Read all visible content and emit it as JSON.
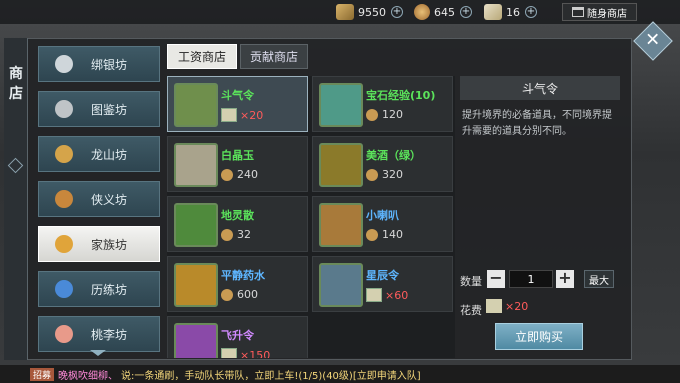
{
  "topbar": {
    "silver": "9550",
    "coins": "645",
    "tickets": "16",
    "shop_label": "随身商店"
  },
  "panel": {
    "vertical_title": "商\n店"
  },
  "sidebar": {
    "items": [
      {
        "label": "绑银坊",
        "icon": "silver-icon",
        "color": "#cfd6da"
      },
      {
        "label": "图鉴坊",
        "icon": "book-icon",
        "color": "#bfc4c7"
      },
      {
        "label": "龙山坊",
        "icon": "dragon-icon",
        "color": "#d5a44a"
      },
      {
        "label": "侠义坊",
        "icon": "medal-icon",
        "color": "#c8873c"
      },
      {
        "label": "家族坊",
        "icon": "ingot-icon",
        "color": "#e0a43a"
      },
      {
        "label": "历练坊",
        "icon": "orb-icon",
        "color": "#4a8ad8"
      },
      {
        "label": "桃李坊",
        "icon": "peach-icon",
        "color": "#e89a8a"
      }
    ]
  },
  "tabs": [
    "工资商店",
    "贡献商店"
  ],
  "items": [
    {
      "name": "斗气令",
      "price": "×20",
      "currency": "ticket",
      "name_color": "green",
      "price_color": "red",
      "icon_color": "#6f8f4c"
    },
    {
      "name": "宝石经验(10)",
      "price": "120",
      "currency": "coin",
      "name_color": "green",
      "price_color": "",
      "icon_color": "#4f9a88"
    },
    {
      "name": "白晶玉",
      "price": "240",
      "currency": "coin",
      "name_color": "green",
      "price_color": "",
      "icon_color": "#a9a38c"
    },
    {
      "name": "美酒（绿）",
      "price": "320",
      "currency": "coin",
      "name_color": "green",
      "price_color": "",
      "icon_color": "#8b7a2a"
    },
    {
      "name": "地灵散",
      "price": "32",
      "currency": "coin",
      "name_color": "green",
      "price_color": "",
      "icon_color": "#4f8a3c"
    },
    {
      "name": "小喇叭",
      "price": "140",
      "currency": "coin",
      "name_color": "blue",
      "price_color": "",
      "icon_color": "#a87a3a"
    },
    {
      "name": "平静药水",
      "price": "600",
      "currency": "coin",
      "name_color": "blue",
      "price_color": "",
      "icon_color": "#b98a2a"
    },
    {
      "name": "星辰令",
      "price": "×60",
      "currency": "ticket",
      "name_color": "blue",
      "price_color": "red",
      "icon_color": "#5a7a8c"
    },
    {
      "name": "飞升令",
      "price": "×150",
      "currency": "ticket",
      "name_color": "purple",
      "price_color": "red",
      "icon_color": "#8a4aa8"
    }
  ],
  "detail": {
    "title": "斗气令",
    "description": "提升境界的必备道具，不同境界提升需要的道具分别不同。",
    "qty_label": "数量",
    "qty_value": "1",
    "minus": "−",
    "plus": "+",
    "max_label": "最大",
    "cost_label": "花费",
    "cost_value": "×20",
    "buy_label": "立即购买"
  },
  "chat": {
    "tag": "招募",
    "speaker": "晚枫吹细柳、",
    "message": "说:一条通刷，手动队长带队，立即上车!(1/5)(40级)[立即申请入队]"
  },
  "colors": {
    "accent": "#5e8fa6",
    "green": "#5be35b",
    "blue": "#5eb6ff",
    "purple": "#d08aff",
    "red": "#ff5b5b"
  }
}
